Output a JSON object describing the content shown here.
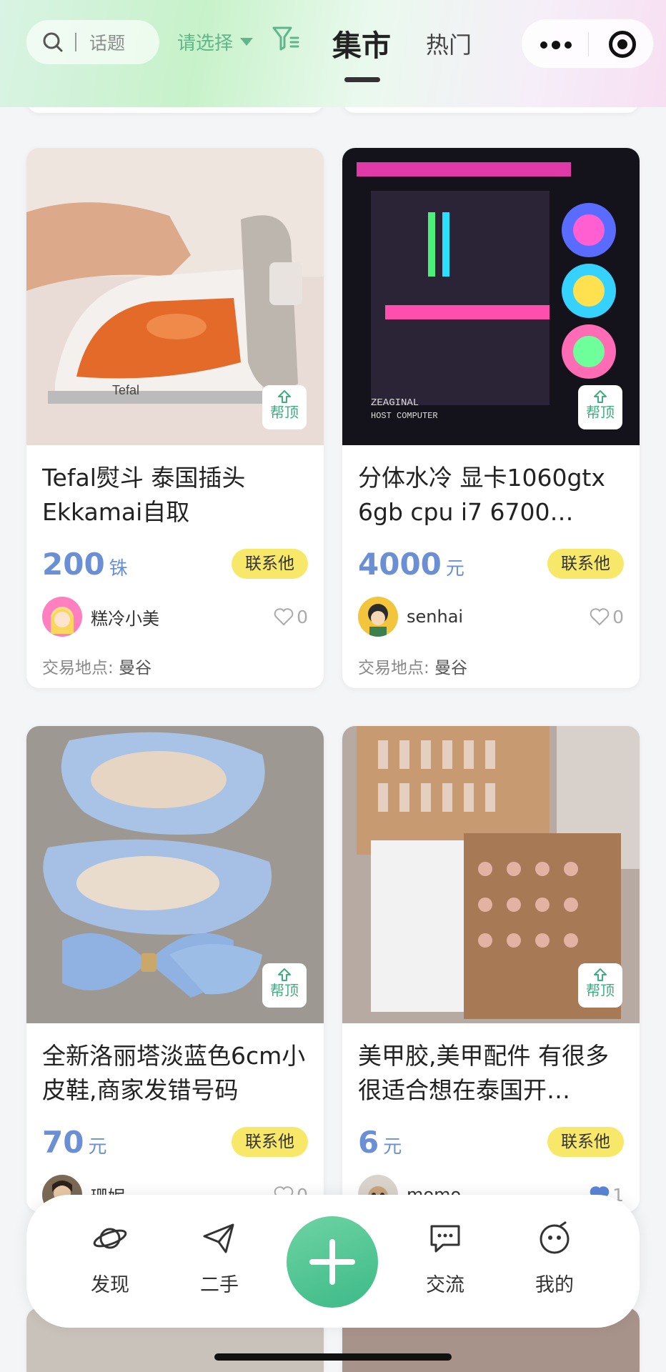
{
  "header": {
    "search_placeholder": "话题",
    "select_label": "请选择",
    "tabs": [
      {
        "label": "集市",
        "active": true
      },
      {
        "label": "热门",
        "active": false
      }
    ]
  },
  "listings": [
    {
      "title": "Tefal熨斗 泰国插头 Ekkamai自取",
      "price": "200",
      "unit": "铢",
      "contact_label": "联系他",
      "boost_label": "帮顶",
      "seller": "糕冷小美",
      "likes": "0",
      "location_label": "交易地点:",
      "location": "曼谷"
    },
    {
      "title": "分体水冷 显卡1060gtx 6gb cpu i7 6700…",
      "price": "4000",
      "unit": "元",
      "contact_label": "联系他",
      "boost_label": "帮顶",
      "seller": "senhai",
      "likes": "0",
      "location_label": "交易地点:",
      "location": "曼谷"
    },
    {
      "title": "全新洛丽塔淡蓝色6cm小皮鞋,商家发错号码",
      "price": "70",
      "unit": "元",
      "contact_label": "联系他",
      "boost_label": "帮顶",
      "seller": "珊妮",
      "likes": "0"
    },
    {
      "title": "美甲胶,美甲配件 有很多很适合想在泰国开…",
      "price": "6",
      "unit": "元",
      "contact_label": "联系他",
      "boost_label": "帮顶",
      "seller": "momo",
      "likes": "1"
    }
  ],
  "bottom_nav": {
    "items": [
      {
        "label": "发现",
        "icon": "planet-icon"
      },
      {
        "label": "二手",
        "icon": "paper-plane-icon"
      },
      {
        "label": "交流",
        "icon": "chat-bubble-icon"
      },
      {
        "label": "我的",
        "icon": "face-icon"
      }
    ],
    "add_icon": "plus-icon"
  },
  "colors": {
    "accent_green": "#3fae7e",
    "price_blue": "#6b8fd4",
    "contact_yellow": "#f8e86a",
    "like_active": "#5b86d6"
  }
}
